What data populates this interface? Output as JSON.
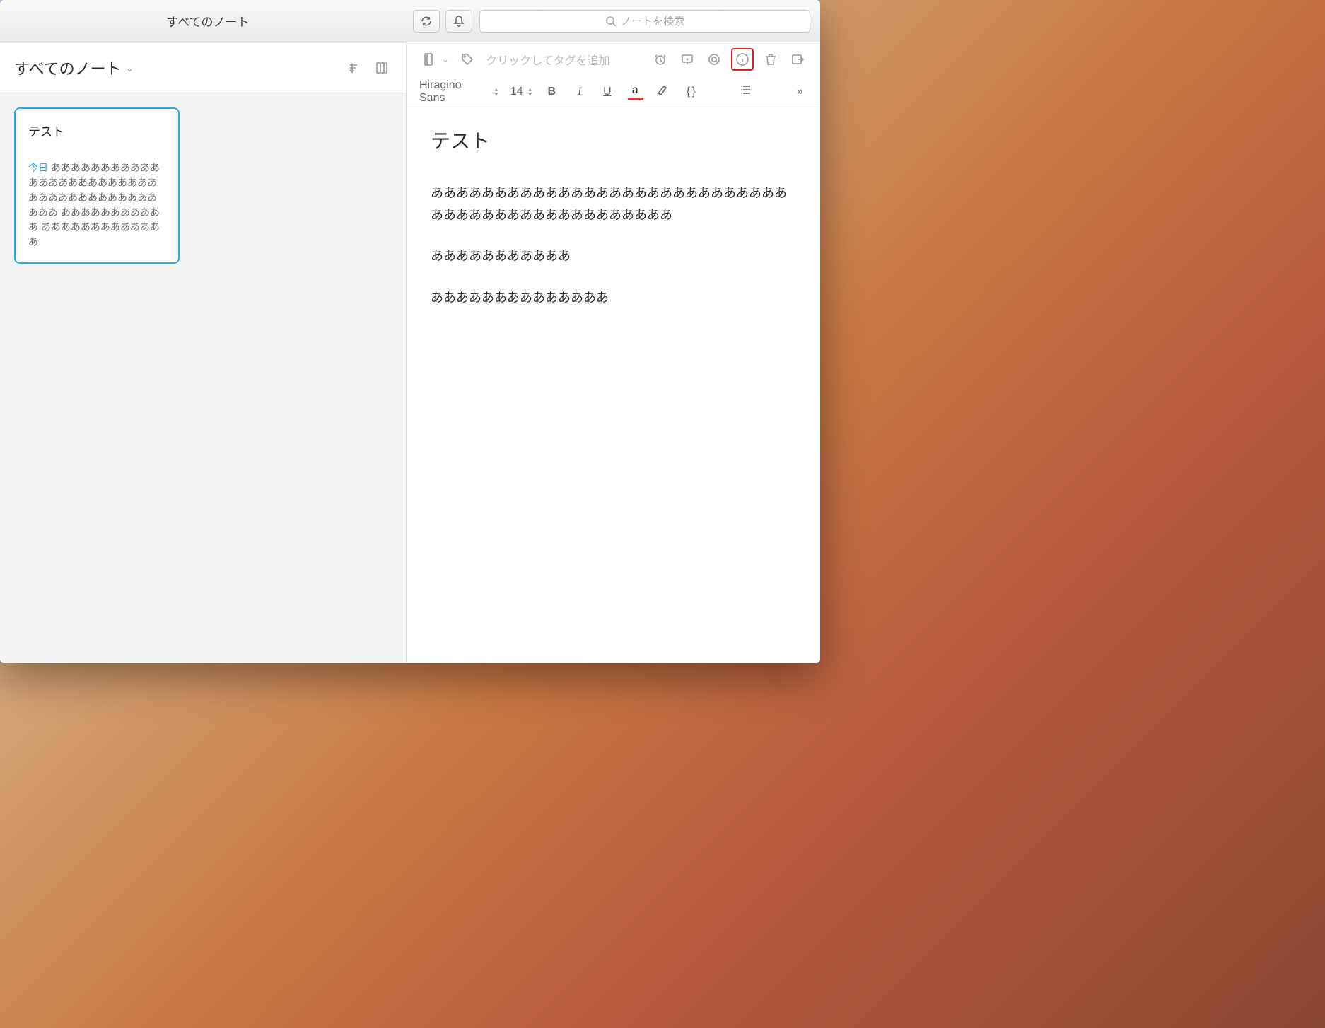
{
  "titlebar": {
    "title": "すべてのノート",
    "search_placeholder": "ノートを検索"
  },
  "sidebar": {
    "title": "すべてのノート",
    "notes": [
      {
        "title": "テスト",
        "date_label": "今日",
        "preview": "ああああああああああああああああああああああああああああああああああああああああ あああああああああああ あああああああああああああ"
      }
    ]
  },
  "editor": {
    "tag_placeholder": "クリックしてタグを追加",
    "font_family": "Hiragino Sans",
    "font_size": "14",
    "format": {
      "bold": "B",
      "italic": "I",
      "underline": "U",
      "color": "a",
      "code": "{ }"
    },
    "title": "テスト",
    "paragraphs": [
      "あああああああああああああああああああああああああああああああああああああああああああああああ",
      "あああああああああああ",
      "ああああああああああああああ"
    ]
  }
}
